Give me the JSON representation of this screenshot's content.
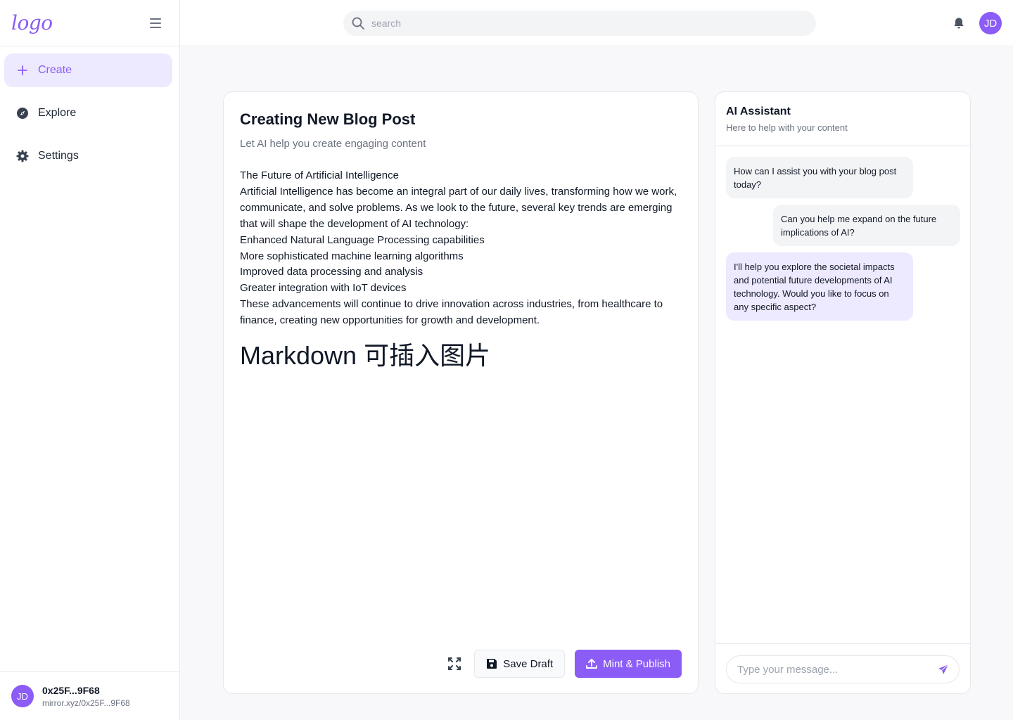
{
  "brand": {
    "logo_text": "logo",
    "accent": "#8b5cf6"
  },
  "sidebar": {
    "items": [
      {
        "label": "Create",
        "icon": "plus-icon",
        "active": true
      },
      {
        "label": "Explore",
        "icon": "compass-icon",
        "active": false
      },
      {
        "label": "Settings",
        "icon": "gear-icon",
        "active": false
      }
    ],
    "user": {
      "initials": "JD",
      "address": "0x25F...9F68",
      "url": "mirror.xyz/0x25F...9F68"
    }
  },
  "header": {
    "search_placeholder": "search",
    "avatar_initials": "JD"
  },
  "editor": {
    "title": "Creating New Blog Post",
    "subtitle": "Let AI help you create engaging content",
    "lines": [
      "The Future of Artificial Intelligence",
      "Artificial Intelligence has become an integral part of our daily lives, transforming how we work, communicate, and solve problems. As we look to the future, several key trends are emerging that will shape the development of AI technology:",
      "Enhanced Natural Language Processing capabilities",
      "More sophisticated machine learning algorithms",
      "Improved data processing and analysis",
      "Greater integration with IoT devices",
      "These advancements will continue to drive innovation across industries, from healthcare to finance, creating new opportunities for growth and development."
    ],
    "markdown_note": "Markdown   可插入图片",
    "save_label": "Save Draft",
    "publish_label": "Mint & Publish"
  },
  "assistant": {
    "title": "AI Assistant",
    "subtitle": "Here to help with your content",
    "messages": [
      {
        "role": "assistant",
        "text": "How can I assist you with your blog post today?"
      },
      {
        "role": "user",
        "text": "Can you help me expand on the future implications of AI?"
      },
      {
        "role": "assistant",
        "text": "I'll help you explore the societal impacts and potential future developments of AI technology. Would you like to focus on any specific aspect?"
      }
    ],
    "input_placeholder": "Type your message..."
  }
}
